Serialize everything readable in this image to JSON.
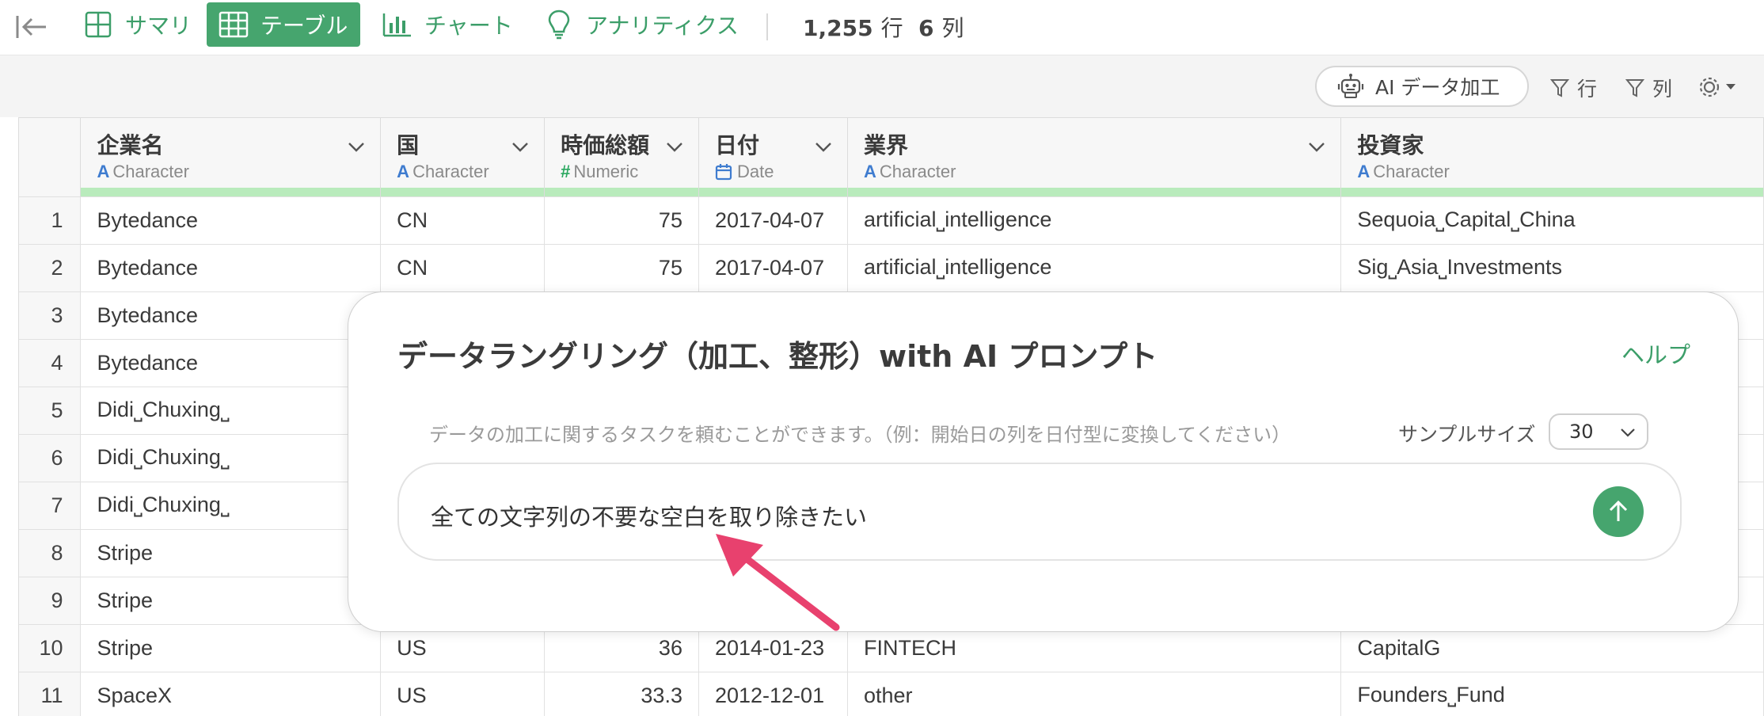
{
  "topbar": {
    "tabs": [
      {
        "label": "サマリ",
        "icon": "table-outline-icon",
        "active": false
      },
      {
        "label": "テーブル",
        "icon": "table-grid-icon",
        "active": true
      },
      {
        "label": "チャート",
        "icon": "bar-chart-icon",
        "active": false
      },
      {
        "label": "アナリティクス",
        "icon": "lightbulb-icon",
        "active": false
      }
    ],
    "rows_count": "1,255",
    "rows_unit": "行",
    "cols_count": "6",
    "cols_unit": "列"
  },
  "toolbar": {
    "ai_button_label": "AI データ加工",
    "filter_rows_label": "行",
    "filter_cols_label": "列"
  },
  "table": {
    "columns": [
      {
        "name": "企業名",
        "type": "Character",
        "type_icon": "A"
      },
      {
        "name": "国",
        "type": "Character",
        "type_icon": "A"
      },
      {
        "name": "時価総額",
        "type": "Numeric",
        "type_icon": "#"
      },
      {
        "name": "日付",
        "type": "Date",
        "type_icon": "calendar-icon"
      },
      {
        "name": "業界",
        "type": "Character",
        "type_icon": "A"
      },
      {
        "name": "投資家",
        "type": "Character",
        "type_icon": "A"
      }
    ],
    "rows": [
      [
        "1",
        "Bytedance",
        "CN",
        "75",
        "2017-04-07",
        "artificial⎵intelligence",
        "Sequoia⎵Capital⎵China"
      ],
      [
        "2",
        "Bytedance",
        "CN",
        "75",
        "2017-04-07",
        "artificial⎵intelligence",
        "Sig⎵Asia⎵Investments"
      ],
      [
        "3",
        "Bytedance",
        "",
        "",
        "",
        "",
        ""
      ],
      [
        "4",
        "Bytedance",
        "",
        "",
        "",
        "",
        ""
      ],
      [
        "5",
        "Didi⎵Chuxing⎵",
        "",
        "",
        "",
        "",
        ""
      ],
      [
        "6",
        "Didi⎵Chuxing⎵",
        "",
        "",
        "",
        "",
        ""
      ],
      [
        "7",
        "Didi⎵Chuxing⎵",
        "",
        "",
        "",
        "",
        ""
      ],
      [
        "8",
        "Stripe",
        "",
        "",
        "",
        "",
        ""
      ],
      [
        "9",
        "Stripe",
        "",
        "",
        "",
        "",
        ""
      ],
      [
        "10",
        "Stripe",
        "US",
        "36",
        "2014-01-23",
        "FINTECH",
        "CapitalG"
      ],
      [
        "11",
        "SpaceX",
        "US",
        "33.3",
        "2012-12-01",
        "other",
        "Founders⎵Fund"
      ]
    ]
  },
  "dialog": {
    "title": "データラングリング（加工、整形）with AI プロンプト",
    "help_label": "ヘルプ",
    "description": "データの加工に関するタスクを頼むことができます。（例：開始日の列を日付型に変換してください）",
    "sample_size_label": "サンプルサイズ",
    "sample_size_value": "30",
    "prompt_text": "全ての文字列の不要な空白を取り除きたい"
  },
  "colors": {
    "accent": "#46a56e",
    "quality_bar": "#b9ebbc",
    "type_character": "#3f7ccf",
    "type_numeric": "#2ba860",
    "annotation_arrow": "#e8416e"
  }
}
